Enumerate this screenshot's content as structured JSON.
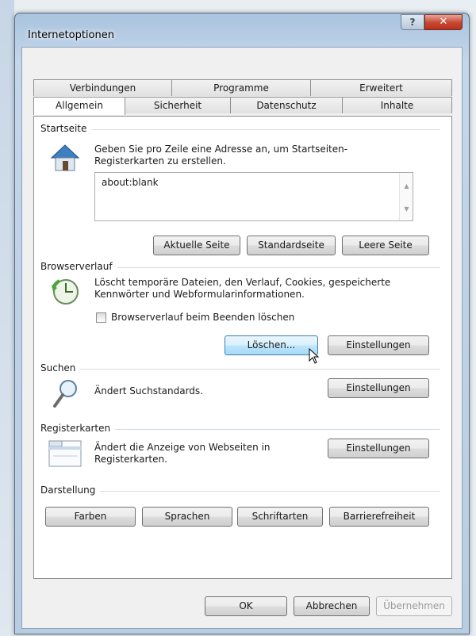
{
  "window": {
    "title": "Internetoptionen",
    "help_glyph": "?",
    "close_glyph": "✕"
  },
  "tabs": {
    "row1": [
      "Verbindungen",
      "Programme",
      "Erweitert"
    ],
    "row2": [
      "Allgemein",
      "Sicherheit",
      "Datenschutz",
      "Inhalte"
    ],
    "active": "Allgemein"
  },
  "startseite": {
    "label": "Startseite",
    "description_line1": "Geben Sie pro Zeile eine Adresse an, um Startseiten-",
    "description_line2": "Registerkarten zu erstellen.",
    "value": "about:blank",
    "buttons": [
      "Aktuelle Seite",
      "Standardseite",
      "Leere Seite"
    ]
  },
  "browserverlauf": {
    "label": "Browserverlauf",
    "description_line1": "Löscht temporäre Dateien, den Verlauf, Cookies, gespeicherte",
    "description_line2": "Kennwörter und Webformularinformationen.",
    "checkbox_label": "Browserverlauf beim Beenden löschen",
    "checkbox_checked": false,
    "delete_button": "Löschen...",
    "settings_button": "Einstellungen"
  },
  "suchen": {
    "label": "Suchen",
    "description": "Ändert Suchstandards.",
    "settings_button": "Einstellungen"
  },
  "registerkarten": {
    "label": "Registerkarten",
    "description_line1": "Ändert die Anzeige von Webseiten in",
    "description_line2": "Registerkarten.",
    "settings_button": "Einstellungen"
  },
  "darstellung": {
    "label": "Darstellung",
    "buttons": [
      "Farben",
      "Sprachen",
      "Schriftarten",
      "Barrierefreiheit"
    ]
  },
  "footer": {
    "ok": "OK",
    "cancel": "Abbrechen",
    "apply": "Übernehmen"
  }
}
